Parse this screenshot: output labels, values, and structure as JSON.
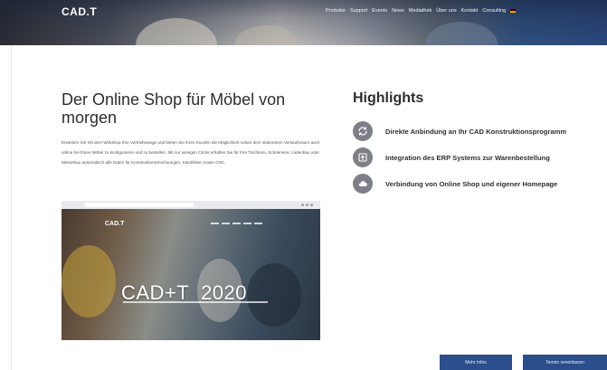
{
  "header": {
    "logo": "CAD.T",
    "nav": [
      "Produkte",
      "Support",
      "Events",
      "News",
      "Mediathek",
      "Über uns",
      "Kontakt",
      "Consulting"
    ]
  },
  "main": {
    "headline": "Der Online Shop für Möbel von morgen",
    "intro": "Erweitern Sie mit dem Webshop Ihre Vertriebswege und bieten Sie Ihren Kunden die Möglichkeit neben dem stationären Verkaufsraum auch online bei Ihnen Möbel zu konfigurieren und zu bestellen. Mit nur wenigen Clicks erhalten Sie für Ihre Tischlerei, Schreinerei, Ladenbau oder Messebau automatisch alle Daten für Konstruktionszeichnungen, Stücklisten sowie CNC.",
    "promo": {
      "logo": "CAD.T",
      "title": "CAD+T  2020"
    }
  },
  "highlights": {
    "title": "Highlights",
    "items": [
      {
        "label": "Direkte Anbindung an Ihr CAD Konstruktionsprogramm",
        "icon": "sync-icon"
      },
      {
        "label": "Integration des ERP Systems zur Warenbestellung",
        "icon": "export-icon"
      },
      {
        "label": "Verbindung von Online Shop und eigener Homepage",
        "icon": "cloud-icon"
      }
    ]
  },
  "footer_buttons": [
    "Mehr Infos",
    "Termin vereinbaren"
  ],
  "colors": {
    "accent": "#2b4e8c",
    "icon_bg": "#7d8087",
    "text": "#2d2d2d"
  }
}
